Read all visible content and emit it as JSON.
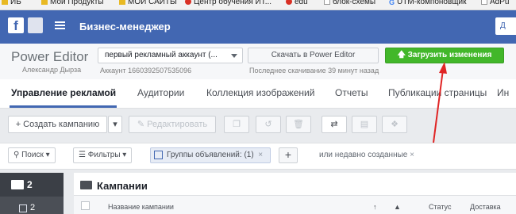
{
  "bookmarks": [
    {
      "label": "ИБ",
      "icon": "folder-icon"
    },
    {
      "label": "Мои Продукты",
      "icon": "folder-icon"
    },
    {
      "label": "МОИ САЙТЫ",
      "icon": "folder-icon"
    },
    {
      "label": "Центр обучения ИТ...",
      "icon": "pin-icon"
    },
    {
      "label": "edu",
      "icon": "pin-icon"
    },
    {
      "label": "блок-схемы",
      "icon": "page-icon"
    },
    {
      "label": "UTM-компоновщик",
      "icon": "google-icon"
    },
    {
      "label": "AdPu",
      "icon": "page-icon"
    }
  ],
  "header": {
    "logo": "f",
    "title": "Бизнес-менеджер",
    "right_button": "Д"
  },
  "power_editor": {
    "title": "Power Editor",
    "user_name": "Александр Дырза",
    "account_select": "первый рекламный аккаунт (...",
    "account_id": "Аккаунт 1660392507535096",
    "download_button": "Скачать в Power Editor",
    "last_download": "Последнее скачивание 39 минут назад",
    "upload_button": "Загрузить изменения"
  },
  "tabs": [
    "Управление рекламой",
    "Аудитории",
    "Коллекция изображений",
    "Отчеты",
    "Публикации страницы",
    "Ин"
  ],
  "toolbar": {
    "create_campaign": "+ Создать кампанию",
    "edit": "Редактировать"
  },
  "filters": {
    "search": "Поиск",
    "filters": "Фильтры",
    "chip_label": "Группы объявлений:",
    "chip_count": "(1)",
    "recent": "или  недавно созданные"
  },
  "left_panel": {
    "top_count": "2",
    "second_count": "2"
  },
  "campaigns": {
    "title": "Кампании",
    "columns": [
      "Название кампании",
      "Статус",
      "Доставка"
    ]
  },
  "colors": {
    "facebook_blue": "#4267b2",
    "upload_green": "#42b72a",
    "annotation_red": "#e02424"
  }
}
